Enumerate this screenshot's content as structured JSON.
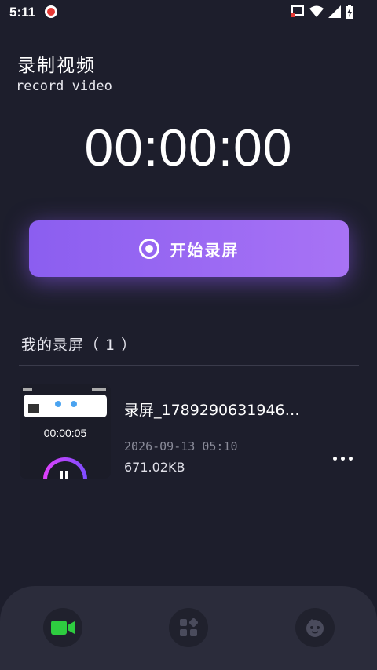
{
  "status_bar": {
    "time": "5:11",
    "icons": [
      "record-indicator-icon",
      "cast-icon",
      "wifi-icon",
      "signal-icon",
      "battery-charging-icon"
    ]
  },
  "header": {
    "title": "录制视频",
    "subtitle": "record video"
  },
  "timer": {
    "value": "00:00:00"
  },
  "start_button": {
    "label": "开始录屏",
    "icon": "record-icon"
  },
  "recordings": {
    "title": "我的录屏（ 1 ）",
    "items": [
      {
        "name": "录屏_1789290631946…",
        "date": "2026-09-13 05:10",
        "size": "671.02KB",
        "thumbnail_timer": "00:00:05"
      }
    ]
  },
  "bottom_nav": {
    "items": [
      {
        "icon": "video-camera-icon",
        "color": "#2ecc40",
        "active": true
      },
      {
        "icon": "apps-grid-icon",
        "active": false
      },
      {
        "icon": "face-icon",
        "active": false
      }
    ]
  },
  "colors": {
    "background": "#1d1e2c",
    "accent": "#9a67f3",
    "nav_background": "#2b2c3b"
  }
}
